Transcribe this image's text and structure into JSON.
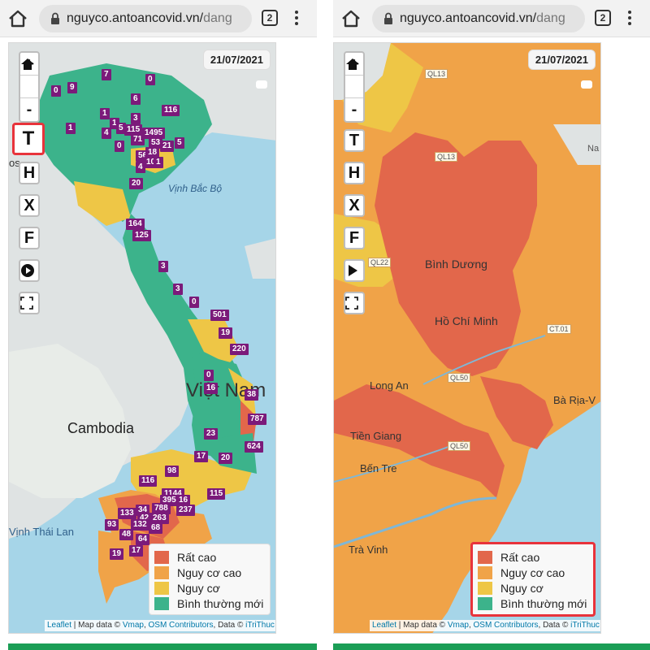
{
  "browser": {
    "url_host": "nguyco.antoancovid.vn/",
    "url_path": "dang",
    "tab_count": "2"
  },
  "map_controls": {
    "zoom_in": "+",
    "zoom_out": "-",
    "layer_buttons": [
      "T",
      "H",
      "X",
      "F"
    ]
  },
  "date": "21/07/2021",
  "legend": [
    {
      "label": "Rất cao",
      "color": "#e2674b"
    },
    {
      "label": "Nguy cơ cao",
      "color": "#f0a348"
    },
    {
      "label": "Nguy cơ",
      "color": "#eec646"
    },
    {
      "label": "Bình thường mới",
      "color": "#3cb38b"
    }
  ],
  "attribution": {
    "leaflet": "Leaflet",
    "map_data_prefix": " | Map data © ",
    "vmap": "Vmap",
    "separator": ", ",
    "osm": "OSM Contributors",
    "data_prefix": ", Data © ",
    "itrithuc": "iTriThuc"
  },
  "left_map": {
    "place_labels": {
      "gulf": "Vịnh Bắc Bộ",
      "vietnam": "Việt Nam",
      "cambodia": "Cambodia",
      "thailand_gulf": "Vịnh Thái Lan",
      "edge": "os"
    },
    "badges": [
      "0",
      "9",
      "7",
      "0",
      "6",
      "1",
      "116",
      "1",
      "3",
      "1",
      "5",
      "115",
      "1495",
      "4",
      "71",
      "53",
      "21",
      "5",
      "0",
      "56",
      "18",
      "10",
      "1",
      "4",
      "20",
      "164",
      "125",
      "3",
      "3",
      "0",
      "501",
      "19",
      "220",
      "0",
      "16",
      "38",
      "787",
      "23",
      "624",
      "17",
      "20",
      "98",
      "116",
      "1144",
      "115",
      "3951",
      "16",
      "237",
      "133",
      "34",
      "788",
      "42",
      "263",
      "93",
      "132",
      "68",
      "48",
      "64",
      "19",
      "17"
    ]
  },
  "right_map": {
    "place_labels": {
      "binh_duong": "Bình Dương",
      "ho_chi_minh": "Hồ Chí Minh",
      "long_an": "Long An",
      "tien_giang": "Tiền Giang",
      "ben_tre": "Bến Tre",
      "tra_vinh": "Trà Vinh",
      "ba_ria": "Bà Rịa-V",
      "na": "Na"
    },
    "road_labels": [
      "QL13",
      "QL13",
      "QL22",
      "CT.01",
      "QL50",
      "QL50"
    ]
  }
}
